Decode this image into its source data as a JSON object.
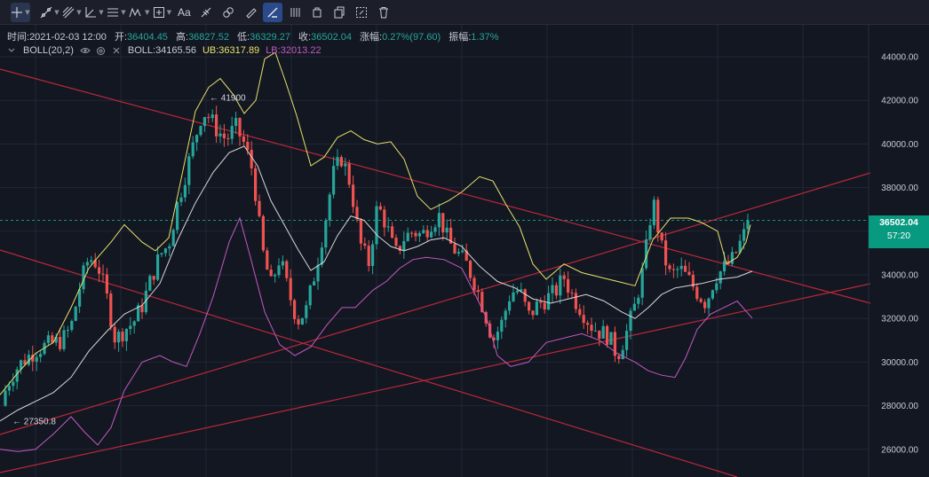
{
  "toolbar": {
    "text_tool_label": "Aa",
    "items": [
      "crosshair-icon",
      "trendline-icon",
      "pitchfork-icon",
      "measure-icon",
      "fib-icon",
      "pattern-icon",
      "add-icon",
      "text-tool",
      "ruler-chain-icon",
      "eraser-link-icon",
      "brush-icon",
      "magnet-active-icon",
      "lock-icon",
      "copy-icon",
      "screenshot-icon",
      "trash-icon"
    ]
  },
  "legend": {
    "time_label": "时间:",
    "time_value": "2021-02-03 12:00",
    "open_label": "开:",
    "open_value": "36404.45",
    "high_label": "高:",
    "high_value": "36827.52",
    "low_label": "低:",
    "low_value": "36329.27",
    "close_label": "收:",
    "close_value": "36502.04",
    "change_label": "涨幅:",
    "change_value": "0.27%(97.60)",
    "amp_label": "振幅:",
    "amp_value": "1.37%"
  },
  "indicator": {
    "name": "BOLL(20,2)",
    "mid_label": "BOLL:",
    "mid_value": "34165.56",
    "ub_label": "UB:",
    "ub_value": "36317.89",
    "lb_label": "LB:",
    "lb_value": "32013.22"
  },
  "colors": {
    "background": "#131722",
    "up": "#26a69a",
    "down": "#ef5350",
    "ub": "#e8e26a",
    "mid": "#d9d9d9",
    "lb": "#c25ac2",
    "trendline": "#b8283a"
  },
  "price_tag": {
    "value": "36502.04",
    "countdown": "57:20"
  },
  "annotations": {
    "high": "← 41900",
    "low": "← 27350.8"
  },
  "chart_data": {
    "type": "candlestick",
    "y_ticks": [
      "44000.00",
      "42000.00",
      "40000.00",
      "38000.00",
      "36000.00",
      "34000.00",
      "32000.00",
      "30000.00",
      "28000.00",
      "26000.00"
    ],
    "ylim": [
      25200,
      45400
    ],
    "grid": true,
    "last_close": 36502.04,
    "high_marker": 41900,
    "low_marker": 27350.8,
    "close_path": [
      [
        0,
        28000
      ],
      [
        6,
        28700
      ],
      [
        12,
        29300
      ],
      [
        20,
        29800
      ],
      [
        30,
        30200
      ],
      [
        42,
        30600
      ],
      [
        55,
        30800
      ],
      [
        70,
        31000
      ],
      [
        80,
        31600
      ],
      [
        90,
        33500
      ],
      [
        100,
        34800
      ],
      [
        110,
        34500
      ],
      [
        120,
        33000
      ],
      [
        130,
        31000
      ],
      [
        140,
        31500
      ],
      [
        150,
        31800
      ],
      [
        160,
        32600
      ],
      [
        170,
        33800
      ],
      [
        180,
        34900
      ],
      [
        190,
        35400
      ],
      [
        200,
        37300
      ],
      [
        210,
        38800
      ],
      [
        220,
        40300
      ],
      [
        228,
        41500
      ],
      [
        236,
        41200
      ],
      [
        245,
        40600
      ],
      [
        255,
        40200
      ],
      [
        265,
        40800
      ],
      [
        275,
        40000
      ],
      [
        285,
        38700
      ],
      [
        295,
        35200
      ],
      [
        305,
        33500
      ],
      [
        315,
        34800
      ],
      [
        325,
        33200
      ],
      [
        335,
        31900
      ],
      [
        345,
        32400
      ],
      [
        355,
        34200
      ],
      [
        365,
        36200
      ],
      [
        375,
        38600
      ],
      [
        385,
        39400
      ],
      [
        395,
        38100
      ],
      [
        405,
        35500
      ],
      [
        415,
        34500
      ],
      [
        425,
        37200
      ],
      [
        435,
        36300
      ],
      [
        445,
        34900
      ],
      [
        455,
        35700
      ],
      [
        465,
        36000
      ],
      [
        475,
        35800
      ],
      [
        485,
        36400
      ],
      [
        495,
        36700
      ],
      [
        505,
        35500
      ],
      [
        515,
        35000
      ],
      [
        525,
        34500
      ],
      [
        535,
        33600
      ],
      [
        545,
        32400
      ],
      [
        555,
        31000
      ],
      [
        565,
        31800
      ],
      [
        575,
        33200
      ],
      [
        585,
        33300
      ],
      [
        595,
        32100
      ],
      [
        605,
        32600
      ],
      [
        615,
        32900
      ],
      [
        625,
        33200
      ],
      [
        635,
        33900
      ],
      [
        645,
        33000
      ],
      [
        655,
        32400
      ],
      [
        665,
        31700
      ],
      [
        675,
        31400
      ],
      [
        685,
        31200
      ],
      [
        695,
        30300
      ],
      [
        705,
        31300
      ],
      [
        715,
        32600
      ],
      [
        725,
        34400
      ],
      [
        735,
        37500
      ],
      [
        745,
        35200
      ],
      [
        755,
        33900
      ],
      [
        765,
        34300
      ],
      [
        775,
        33800
      ],
      [
        785,
        33200
      ],
      [
        795,
        32700
      ],
      [
        805,
        33900
      ],
      [
        815,
        34300
      ],
      [
        825,
        34700
      ],
      [
        835,
        35600
      ],
      [
        845,
        36502
      ]
    ],
    "series": [
      {
        "name": "UB",
        "values": [
          [
            0,
            28500
          ],
          [
            20,
            29500
          ],
          [
            40,
            30400
          ],
          [
            60,
            30900
          ],
          [
            80,
            32500
          ],
          [
            100,
            34300
          ],
          [
            110,
            34800
          ],
          [
            125,
            35500
          ],
          [
            140,
            36300
          ],
          [
            160,
            35500
          ],
          [
            175,
            35100
          ],
          [
            190,
            35700
          ],
          [
            205,
            38600
          ],
          [
            220,
            41500
          ],
          [
            235,
            42600
          ],
          [
            248,
            43000
          ],
          [
            262,
            42300
          ],
          [
            275,
            41400
          ],
          [
            288,
            42000
          ],
          [
            298,
            43900
          ],
          [
            310,
            44200
          ],
          [
            322,
            42800
          ],
          [
            334,
            41300
          ],
          [
            350,
            39000
          ],
          [
            365,
            39400
          ],
          [
            380,
            40300
          ],
          [
            395,
            40600
          ],
          [
            410,
            40200
          ],
          [
            425,
            40000
          ],
          [
            440,
            40100
          ],
          [
            455,
            39300
          ],
          [
            470,
            37600
          ],
          [
            485,
            37000
          ],
          [
            505,
            37400
          ],
          [
            520,
            37800
          ],
          [
            540,
            38500
          ],
          [
            555,
            38300
          ],
          [
            570,
            37200
          ],
          [
            585,
            36200
          ],
          [
            600,
            34500
          ],
          [
            615,
            33800
          ],
          [
            635,
            34500
          ],
          [
            655,
            34100
          ],
          [
            675,
            33900
          ],
          [
            695,
            33700
          ],
          [
            715,
            33500
          ],
          [
            735,
            35600
          ],
          [
            755,
            36600
          ],
          [
            775,
            36600
          ],
          [
            790,
            36400
          ],
          [
            808,
            36000
          ],
          [
            818,
            34500
          ],
          [
            830,
            34800
          ],
          [
            840,
            35500
          ],
          [
            845,
            36300
          ]
        ]
      },
      {
        "name": "BOLL",
        "values": [
          [
            0,
            27300
          ],
          [
            20,
            27800
          ],
          [
            40,
            28200
          ],
          [
            60,
            28600
          ],
          [
            80,
            29300
          ],
          [
            100,
            30500
          ],
          [
            120,
            31400
          ],
          [
            140,
            32200
          ],
          [
            160,
            32600
          ],
          [
            180,
            33600
          ],
          [
            200,
            35600
          ],
          [
            220,
            37300
          ],
          [
            240,
            38700
          ],
          [
            258,
            39600
          ],
          [
            275,
            39900
          ],
          [
            290,
            39000
          ],
          [
            305,
            37400
          ],
          [
            320,
            36300
          ],
          [
            335,
            35200
          ],
          [
            350,
            34200
          ],
          [
            365,
            34600
          ],
          [
            380,
            35800
          ],
          [
            395,
            36700
          ],
          [
            410,
            36500
          ],
          [
            425,
            35800
          ],
          [
            440,
            35300
          ],
          [
            455,
            35100
          ],
          [
            470,
            35300
          ],
          [
            485,
            35600
          ],
          [
            500,
            35700
          ],
          [
            520,
            35300
          ],
          [
            540,
            34400
          ],
          [
            560,
            33700
          ],
          [
            580,
            33400
          ],
          [
            600,
            32900
          ],
          [
            620,
            32700
          ],
          [
            640,
            32900
          ],
          [
            660,
            33100
          ],
          [
            680,
            32800
          ],
          [
            700,
            32300
          ],
          [
            715,
            32000
          ],
          [
            730,
            32500
          ],
          [
            745,
            33100
          ],
          [
            760,
            33400
          ],
          [
            775,
            33500
          ],
          [
            790,
            33600
          ],
          [
            810,
            33800
          ],
          [
            830,
            33900
          ],
          [
            847,
            34165
          ]
        ]
      },
      {
        "name": "LB",
        "values": [
          [
            0,
            26000
          ],
          [
            20,
            25900
          ],
          [
            40,
            26000
          ],
          [
            60,
            26700
          ],
          [
            80,
            27500
          ],
          [
            95,
            26800
          ],
          [
            110,
            26200
          ],
          [
            125,
            27000
          ],
          [
            140,
            28700
          ],
          [
            160,
            30000
          ],
          [
            180,
            30300
          ],
          [
            195,
            30000
          ],
          [
            210,
            29800
          ],
          [
            225,
            31300
          ],
          [
            240,
            33000
          ],
          [
            258,
            35500
          ],
          [
            270,
            36600
          ],
          [
            282,
            34800
          ],
          [
            298,
            32300
          ],
          [
            315,
            30800
          ],
          [
            332,
            30300
          ],
          [
            350,
            30700
          ],
          [
            368,
            31700
          ],
          [
            385,
            32500
          ],
          [
            400,
            32500
          ],
          [
            420,
            33300
          ],
          [
            435,
            33700
          ],
          [
            450,
            34300
          ],
          [
            465,
            34700
          ],
          [
            480,
            34800
          ],
          [
            500,
            34700
          ],
          [
            520,
            34300
          ],
          [
            535,
            33100
          ],
          [
            548,
            32000
          ],
          [
            560,
            30300
          ],
          [
            575,
            29800
          ],
          [
            595,
            30000
          ],
          [
            615,
            30900
          ],
          [
            635,
            31100
          ],
          [
            655,
            31300
          ],
          [
            675,
            31000
          ],
          [
            695,
            30400
          ],
          [
            715,
            30000
          ],
          [
            730,
            29600
          ],
          [
            745,
            29400
          ],
          [
            760,
            29300
          ],
          [
            772,
            30200
          ],
          [
            785,
            31500
          ],
          [
            800,
            32200
          ],
          [
            815,
            32500
          ],
          [
            830,
            32800
          ],
          [
            847,
            32013
          ]
        ]
      }
    ]
  }
}
